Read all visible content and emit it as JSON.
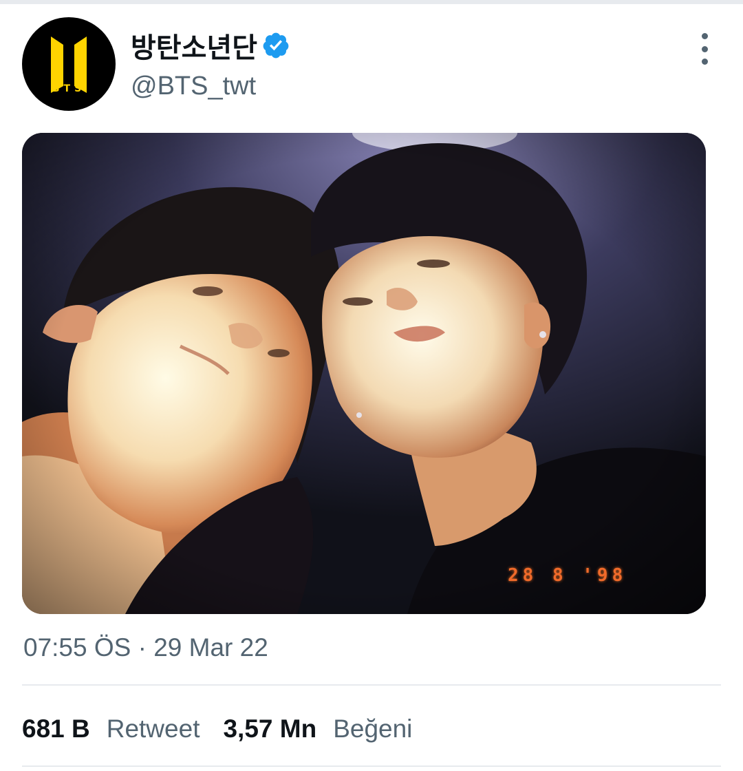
{
  "tweet": {
    "author": {
      "display_name": "방탄소년단",
      "handle": "@BTS_twt",
      "verified": true,
      "avatar_text": "BTS",
      "avatar_color": "#ffd400"
    },
    "more_icon": "more-vertical-icon",
    "photo": {
      "date_stamp": "28 8 '98",
      "stamp_color": "#f06a2a"
    },
    "timestamp": "07:55 ÖS · 29 Mar 22",
    "stats": {
      "retweets_value": "681 B",
      "retweets_label": "Retweet",
      "likes_value": "3,57 Mn",
      "likes_label": "Beğeni"
    },
    "colors": {
      "verified": "#1d9bf0",
      "secondary_text": "#536471",
      "primary_text": "#0f1419",
      "divider": "#e7eaee"
    }
  }
}
